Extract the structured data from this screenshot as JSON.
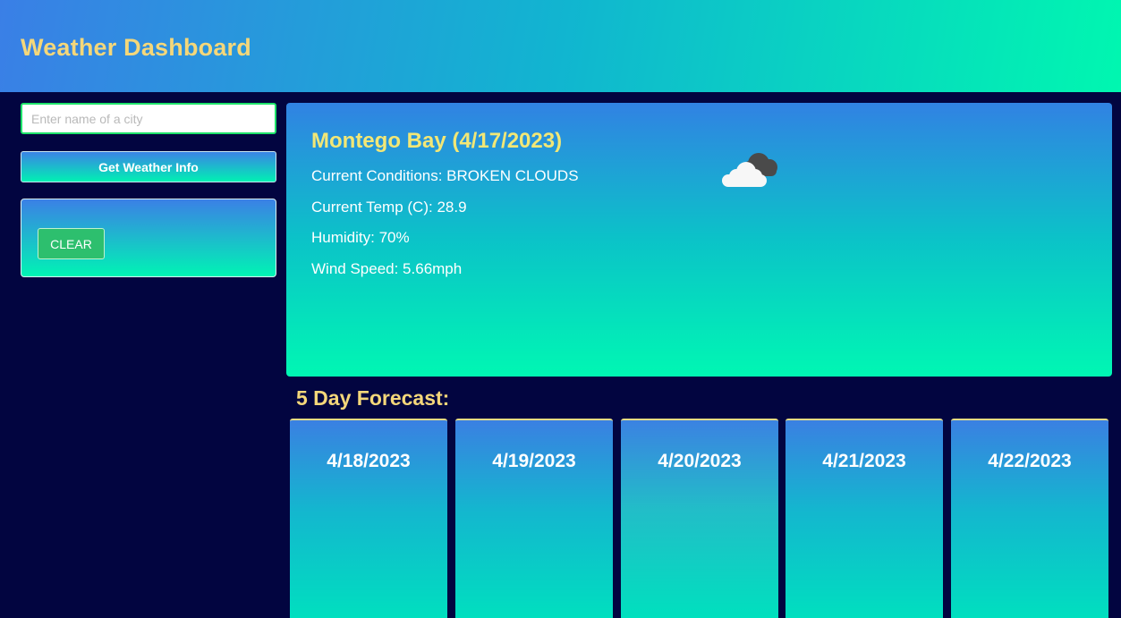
{
  "header": {
    "title": "Weather Dashboard"
  },
  "search": {
    "placeholder": "Enter name of a city",
    "value": "",
    "submit_label": "Get Weather Info"
  },
  "history": {
    "clear_label": "CLEAR"
  },
  "current": {
    "city_date": "Montego Bay (4/17/2023)",
    "conditions": "Current Conditions: BROKEN CLOUDS",
    "temp": "Current Temp (C): 28.9",
    "humidity": "Humidity: 70%",
    "wind": "Wind Speed: 5.66mph",
    "icon": "broken-clouds-icon"
  },
  "forecast": {
    "title": "5 Day Forecast:",
    "days": [
      {
        "date": "4/18/2023"
      },
      {
        "date": "4/19/2023"
      },
      {
        "date": "4/20/2023"
      },
      {
        "date": "4/21/2023"
      },
      {
        "date": "4/22/2023"
      }
    ]
  },
  "colors": {
    "background": "#020540",
    "title_gold": "#f4d77a",
    "city_yellow": "#f2e776",
    "accent_green": "#2dbf6e"
  }
}
